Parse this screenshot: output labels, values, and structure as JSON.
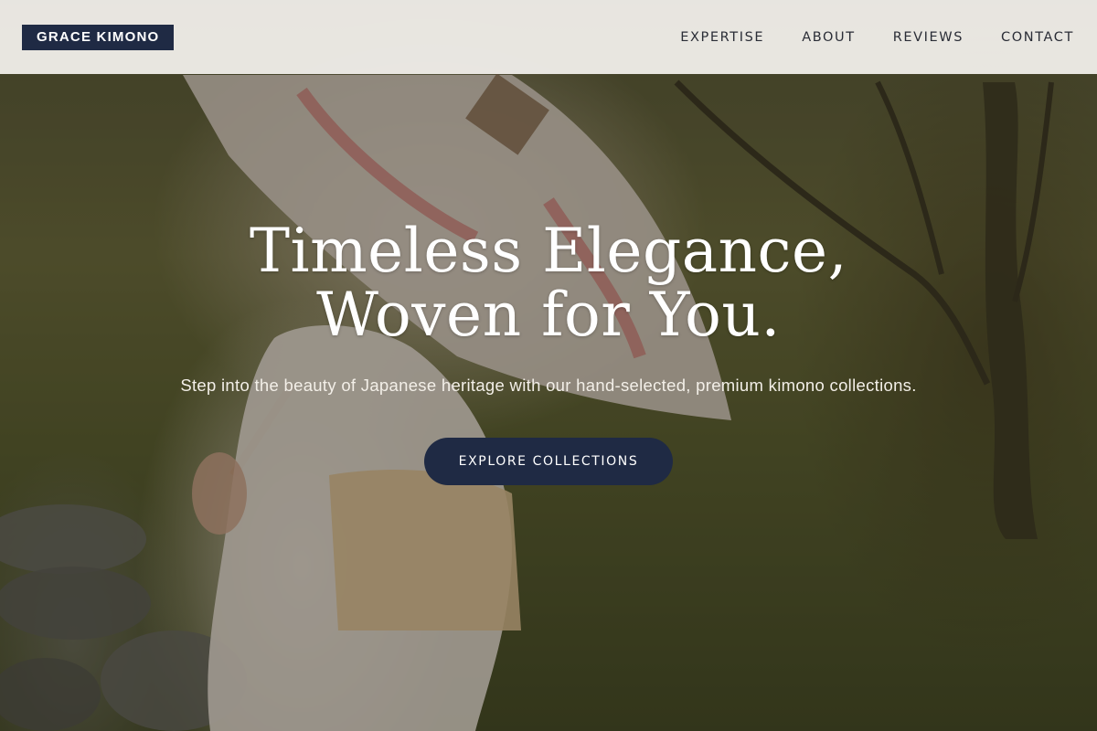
{
  "header": {
    "logo": "GRACE KIMONO",
    "nav": [
      {
        "label": "EXPERTISE"
      },
      {
        "label": "ABOUT"
      },
      {
        "label": "REVIEWS"
      },
      {
        "label": "CONTACT"
      }
    ]
  },
  "hero": {
    "title_line1": "Timeless Elegance,",
    "title_line2": "Woven for You.",
    "subtitle": "Step into the beauty of Japanese heritage with our hand-selected, premium kimono collections.",
    "cta_label": "EXPLORE COLLECTIONS",
    "background_image": "woman-in-kimono-with-parasol-in-garden"
  },
  "colors": {
    "accent": "#1f2a44",
    "header_bg": "#f2f0ec",
    "text_light": "#ffffff"
  }
}
